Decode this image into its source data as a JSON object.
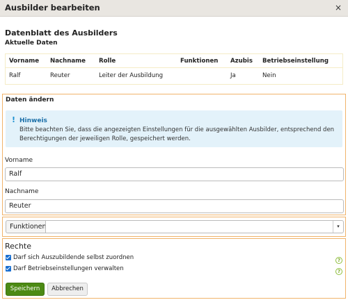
{
  "dialog": {
    "title": "Ausbilder bearbeiten",
    "close_symbol": "×"
  },
  "datasheet": {
    "heading": "Datenblatt des Ausbilders",
    "current_heading": "Aktuelle Daten",
    "columns": [
      "Vorname",
      "Nachname",
      "Rolle",
      "Funktionen",
      "Azubis",
      "Betriebseinstellung"
    ],
    "rows": [
      [
        "Ralf",
        "Reuter",
        "Leiter der Ausbildung",
        "",
        "Ja",
        "Nein"
      ]
    ]
  },
  "change": {
    "heading": "Daten ändern",
    "hint": {
      "icon": "exclamation-icon",
      "symbol": "!",
      "title": "Hinweis",
      "text": "Bitte beachten Sie, dass die angezeigten Einstellungen für die ausgewählten Ausbilder, entsprechend den Berechtigungen der jeweiligen Rolle, gespeichert werden."
    },
    "firstname": {
      "label": "Vorname",
      "value": "Ralf"
    },
    "lastname": {
      "label": "Nachname",
      "value": "Reuter"
    }
  },
  "functions": {
    "label": "Funktionen",
    "value": "",
    "arrow": "▾"
  },
  "rights": {
    "heading": "Rechte",
    "items": [
      {
        "label": "Darf sich Auszubildende selbst zuordnen",
        "checked": true,
        "help": "?"
      },
      {
        "label": "Darf Betriebseinstellungen verwalten",
        "checked": true,
        "help": "?"
      }
    ]
  },
  "actions": {
    "save_label": "Speichern",
    "cancel_label": "Abbrechen"
  },
  "colors": {
    "accent_border": "#f0b36a",
    "save_button": "#4c8a14",
    "hint_background": "#e3f2fa",
    "checkbox": "#1a6fd0"
  }
}
